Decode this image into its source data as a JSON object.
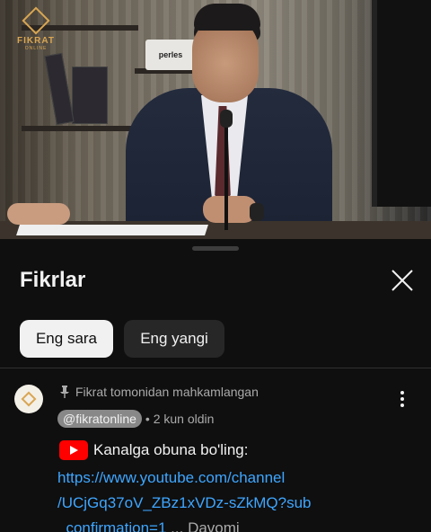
{
  "video": {
    "channel_logo_text": "FIKRAT",
    "channel_logo_sub": "ONLINE",
    "sign_text": "perles"
  },
  "comments_sheet": {
    "title": "Fikrlar",
    "filters": [
      {
        "label": "Eng sara",
        "selected": true
      },
      {
        "label": "Eng yangi",
        "selected": false
      }
    ],
    "pinned_comment": {
      "pinned_label": "Fikrat tomonidan mahkamlangan",
      "author": "@fikratonline",
      "time": "• 2 kun oldin",
      "text": "Kanalga obuna bo'ling:",
      "link_lines": [
        "https://www.youtube.com/channel",
        "/UCjGq37oV_ZBz1xVDz-sZkMQ?sub",
        "_confirmation=1"
      ],
      "more_label": "... Davomi"
    }
  },
  "colors": {
    "background": "#0f0f0f",
    "link": "#3ea6ff",
    "youtube_red": "#ff0000",
    "logo_gold": "#d9a652"
  },
  "icons": [
    "close-icon",
    "pin-icon",
    "more-vert-icon",
    "youtube-icon"
  ]
}
